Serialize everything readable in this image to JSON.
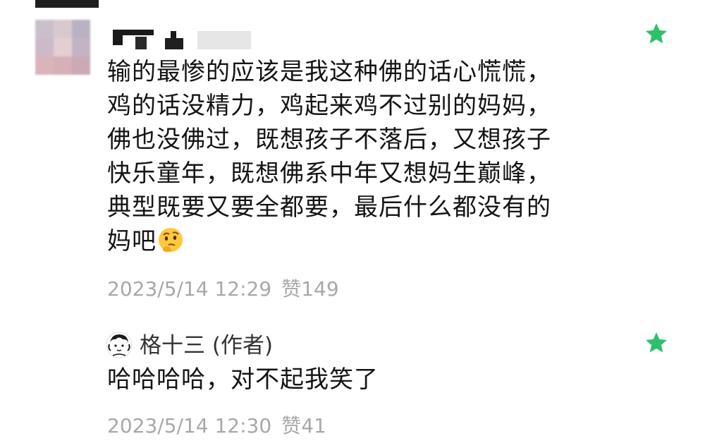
{
  "comment": {
    "lines": [
      "输的最惨的应该是我这种佛的话心慌慌，",
      "鸡的话没精力，鸡起来鸡不过别的妈妈，",
      "佛也没佛过，既想孩子不落后，又想孩子",
      "快乐童年，既想佛系中年又想妈生巅峰，",
      "典型既要又要全都要，最后什么都没有的",
      "妈吧"
    ],
    "emoji": "thinking-face-icon",
    "timestamp": "2023/5/14 12:29",
    "like_label": "赞",
    "like_count": "149",
    "star_color": "#2fc06a"
  },
  "reply": {
    "author": "格十三 (作者)",
    "text": "哈哈哈哈，对不起我笑了",
    "timestamp": "2023/5/14 12:30",
    "like_label": "赞",
    "like_count": "41",
    "star_color": "#2fc06a"
  }
}
